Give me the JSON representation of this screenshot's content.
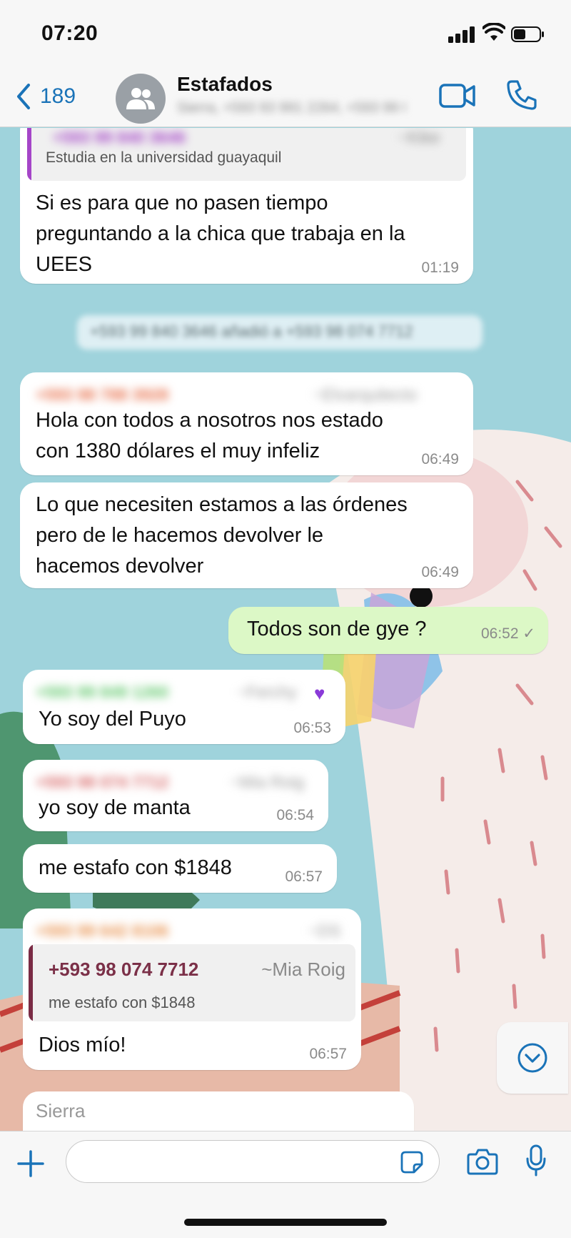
{
  "status_bar": {
    "time": "07:20"
  },
  "header": {
    "back_count": "189",
    "title": "Estafados",
    "subtitle": "Sierra, +593 93 991 2264, +593 99 840 1260"
  },
  "messages": [
    {
      "sender": "+593 99 840 3646",
      "sender_alias": "~Kike",
      "quote_text": "Estudia en la universidad guayaquil",
      "text_lines": [
        "Si es para que no pasen tiempo",
        "preguntando a la chica que trabaja en la",
        "UEES"
      ],
      "time": "01:19"
    },
    {
      "system": "+593 99 840 3646 añadió a +593 98 074 7712"
    },
    {
      "sender": "+593 98 788 3928",
      "sender_alias": "~Elvarquitecto",
      "text_lines": [
        "Hola con todos a nosotros nos estado",
        "con 1380 dólares el muy infeliz"
      ],
      "time": "06:49"
    },
    {
      "text_lines": [
        "Lo que necesiten estamos a las órdenes",
        "pero de le hacemos devolver le",
        "hacemos devolver"
      ],
      "time": "06:49"
    },
    {
      "outgoing": true,
      "text_lines": [
        "Todos son de gye ?"
      ],
      "time": "06:52",
      "status": "✓"
    },
    {
      "sender": "+593 99 849 1260",
      "sender_alias": "~Ferchy",
      "text_lines": [
        "Yo soy del Puyo"
      ],
      "time": "06:53"
    },
    {
      "sender": "+593 98 074 7712",
      "sender_alias": "~Mia Roig",
      "text_lines": [
        "yo soy de manta"
      ],
      "time": "06:54"
    },
    {
      "text_lines": [
        "me estafo con $1848"
      ],
      "time": "06:57"
    },
    {
      "sender": "+593 99 642 8106",
      "sender_alias": "~DS",
      "quote_sender": "+593 98 074 7712",
      "quote_alias": "~Mia Roig",
      "quote_text": "me estafo con $1848",
      "text_lines": [
        "Dios mío!"
      ],
      "time": "06:57"
    },
    {
      "sender_label": "Sierra"
    }
  ],
  "composer": {
    "placeholder": ""
  },
  "colors": {
    "ios_blue": "#1a73b8",
    "outgoing_bubble": "#dcf8c6",
    "incoming_bubble": "#ffffff",
    "wallpaper": "#9fd3dc",
    "quote_bar_purple": "#a545c8",
    "quote_bar_maroon": "#7a2b45",
    "quote_sender_maroon": "#7b3048"
  },
  "icons": [
    "back-chevron-icon",
    "group-avatar-icon",
    "video-call-icon",
    "phone-icon",
    "scroll-down-icon",
    "plus-icon",
    "sticker-icon",
    "camera-icon",
    "microphone-icon",
    "checkmark-icon"
  ]
}
